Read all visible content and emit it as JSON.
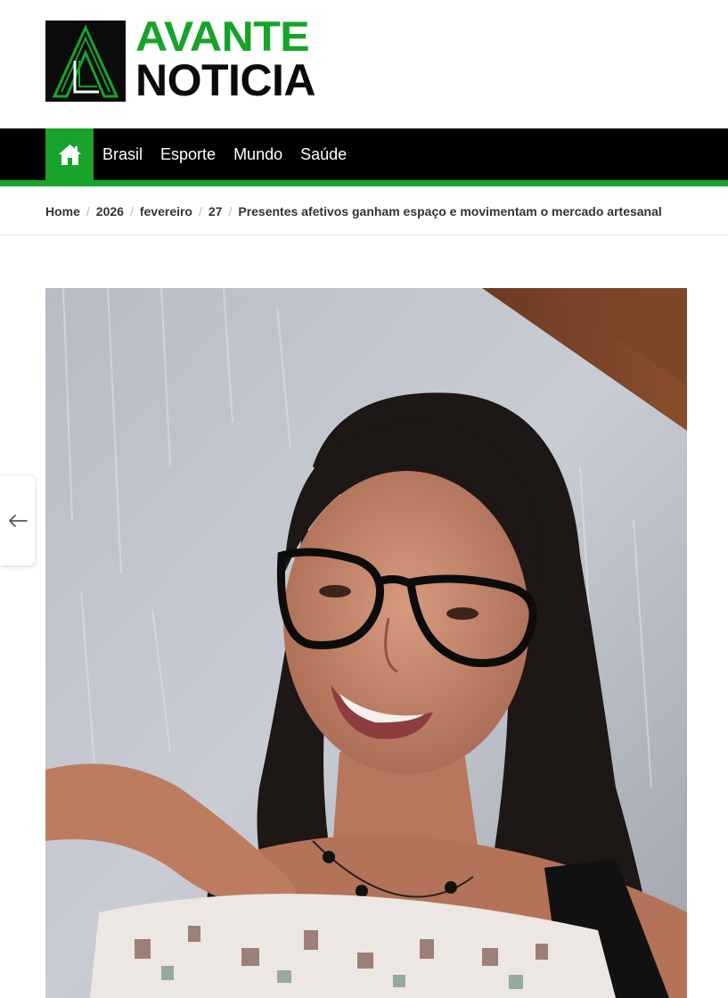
{
  "site": {
    "logo_line1": "AVANTE",
    "logo_line2": "NOTICIA",
    "brand_color": "#18a32a"
  },
  "nav": {
    "home_icon": "home-icon",
    "items": [
      {
        "label": "Brasil"
      },
      {
        "label": "Esporte"
      },
      {
        "label": "Mundo"
      },
      {
        "label": "Saúde"
      }
    ]
  },
  "breadcrumb": {
    "items": [
      "Home",
      "2026",
      "fevereiro",
      "27",
      "Presentes afetivos ganham espaço e movimentam o mercado artesanal"
    ],
    "separator": "/"
  },
  "article": {
    "featured_image": "woman-with-glasses-holding-pouch"
  },
  "prev_nav": {
    "icon": "arrow-left-icon"
  }
}
